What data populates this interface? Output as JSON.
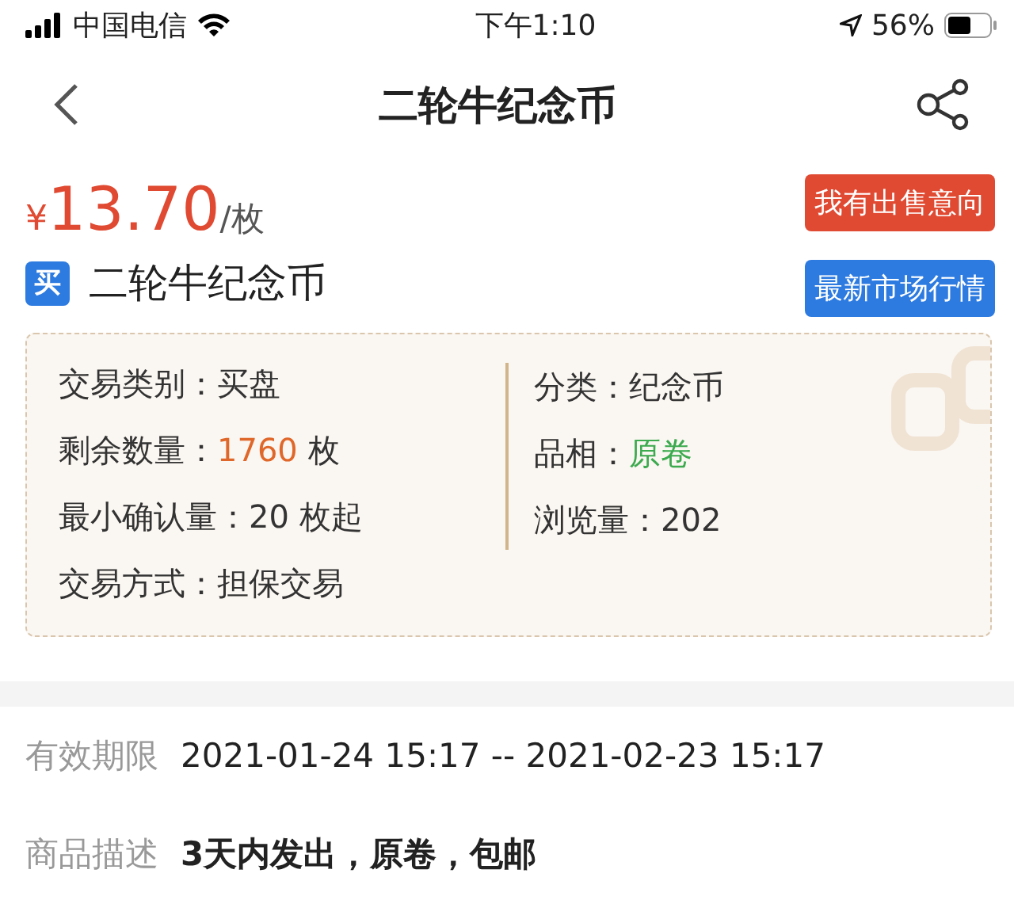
{
  "status_bar": {
    "carrier": "中国电信",
    "time": "下午1:10",
    "battery": "56%"
  },
  "nav": {
    "title": "二轮牛纪念币"
  },
  "price": {
    "currency": "¥",
    "amount": "13.70",
    "unit": "/枚"
  },
  "product": {
    "badge": "买",
    "name": "二轮牛纪念币"
  },
  "buttons": [
    {
      "label": "我有出售意向",
      "color": "#e04a32"
    },
    {
      "label": "最新市场行情",
      "color": "#2d7be0"
    }
  ],
  "info_left": [
    {
      "label": "交易类别：",
      "value": "买盘",
      "color": "#333333"
    },
    {
      "label": "剩余数量：",
      "value": "1760",
      "unit": " 枚",
      "color": "#e0672a"
    },
    {
      "label": "最小确认量：",
      "value": "20 枚起",
      "color": "#333333"
    },
    {
      "label": "交易方式：",
      "value": "担保交易",
      "color": "#333333"
    }
  ],
  "info_right": [
    {
      "label": "分类：",
      "value": "纪念币",
      "color": "#333333"
    },
    {
      "label": "品相：",
      "value": "原卷",
      "color": "#3caa4e"
    },
    {
      "label": "浏览量：",
      "value": "202",
      "color": "#333333"
    }
  ],
  "details": [
    {
      "label": "有效期限",
      "value": "2021-01-24 15:17 -- 2021-02-23 15:17",
      "bold": false
    },
    {
      "label": "商品描述",
      "value": "3天内发出，原卷，包邮",
      "bold": true
    }
  ]
}
